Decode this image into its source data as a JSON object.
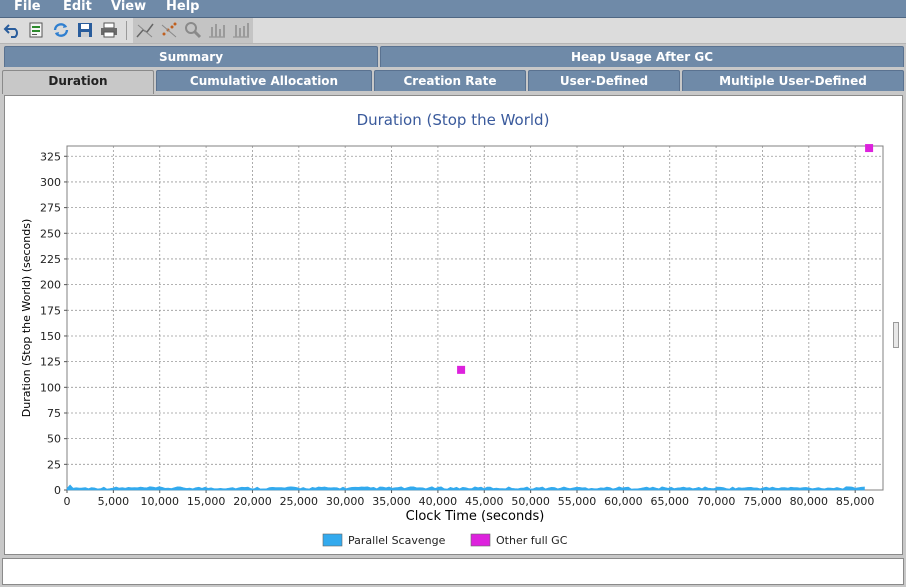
{
  "menu": {
    "file": "File",
    "edit": "Edit",
    "view": "View",
    "help": "Help"
  },
  "toolbar": {
    "icons": [
      "undo-icon",
      "open-icon",
      "refresh-icon",
      "save-icon",
      "print-icon",
      "zoom-line-icon",
      "zoom-scatter-icon",
      "magnifier-icon",
      "bar-chart-icon",
      "bar-chart-alt-icon"
    ]
  },
  "tabs": {
    "row1": [
      "Summary",
      "Heap Usage After GC"
    ],
    "row2": [
      "Duration",
      "Cumulative Allocation",
      "Creation Rate",
      "User-Defined",
      "Multiple User-Defined"
    ],
    "active": "Duration"
  },
  "colors": {
    "title": "#3a5a9c",
    "parallel_scavenge": "#33aaee",
    "other_full_gc": "#dd22dd",
    "grid": "#999999"
  },
  "chart_data": {
    "type": "scatter",
    "title": "Duration (Stop the World)",
    "xlabel": "Clock Time  (seconds)",
    "ylabel": "Duration (Stop the World)  (seconds)",
    "xlim": [
      0,
      88000
    ],
    "ylim": [
      0,
      335
    ],
    "xticks": [
      0,
      5000,
      10000,
      15000,
      20000,
      25000,
      30000,
      35000,
      40000,
      45000,
      50000,
      55000,
      60000,
      65000,
      70000,
      75000,
      80000,
      85000
    ],
    "xtick_labels": [
      "0",
      "5,000",
      "10,000",
      "15,000",
      "20,000",
      "25,000",
      "30,000",
      "35,000",
      "40,000",
      "45,000",
      "50,000",
      "55,000",
      "60,000",
      "65,000",
      "70,000",
      "75,000",
      "80,000",
      "85,000"
    ],
    "yticks": [
      0,
      25,
      50,
      75,
      100,
      125,
      150,
      175,
      200,
      225,
      250,
      275,
      300,
      325
    ],
    "grid": true,
    "legend_position": "bottom",
    "series": [
      {
        "name": "Parallel Scavenge",
        "color": "#33aaee",
        "style": "band",
        "x": [
          0,
          86000
        ],
        "y_max": 4
      },
      {
        "name": "Other full GC",
        "color": "#dd22dd",
        "style": "squares",
        "x": [
          42500,
          86500
        ],
        "y": [
          117,
          333
        ]
      }
    ]
  }
}
